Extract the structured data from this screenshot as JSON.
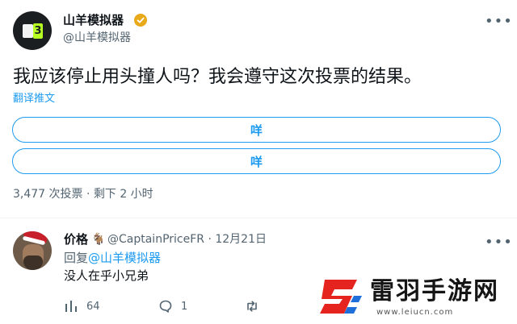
{
  "tweet": {
    "author_name": "山羊模拟器",
    "author_handle": "@山羊模拟器",
    "text": "我应该停止用头撞人吗？我会遵守这次投票的结果。",
    "translate_label": "翻译推文",
    "poll": {
      "options": [
        {
          "label": "咩"
        },
        {
          "label": "咩"
        }
      ],
      "meta": "3,477 次投票 · 剩下 2 小时"
    }
  },
  "reply": {
    "name": "价格",
    "emoji": "🐐",
    "meta": "@CaptainPriceFR · 12月21日",
    "reply_prefix": "回复",
    "reply_to": "@山羊模拟器",
    "text": "没人在乎小兄弟",
    "actions": {
      "views": "64",
      "replies": "1"
    }
  },
  "watermark": {
    "title": "雷羽手游网",
    "url": "www.leiucn.com"
  },
  "icons": {
    "more": "more-icon",
    "verified": "verified-badge-icon",
    "views": "bar-chart-icon",
    "reply": "comment-icon",
    "retweet": "retweet-icon"
  },
  "colors": {
    "accent": "#1d9bf0",
    "muted": "#536471",
    "verified": "#e8a91a",
    "watermark_red": "#e52420",
    "watermark_blue": "#1e6fd9"
  }
}
